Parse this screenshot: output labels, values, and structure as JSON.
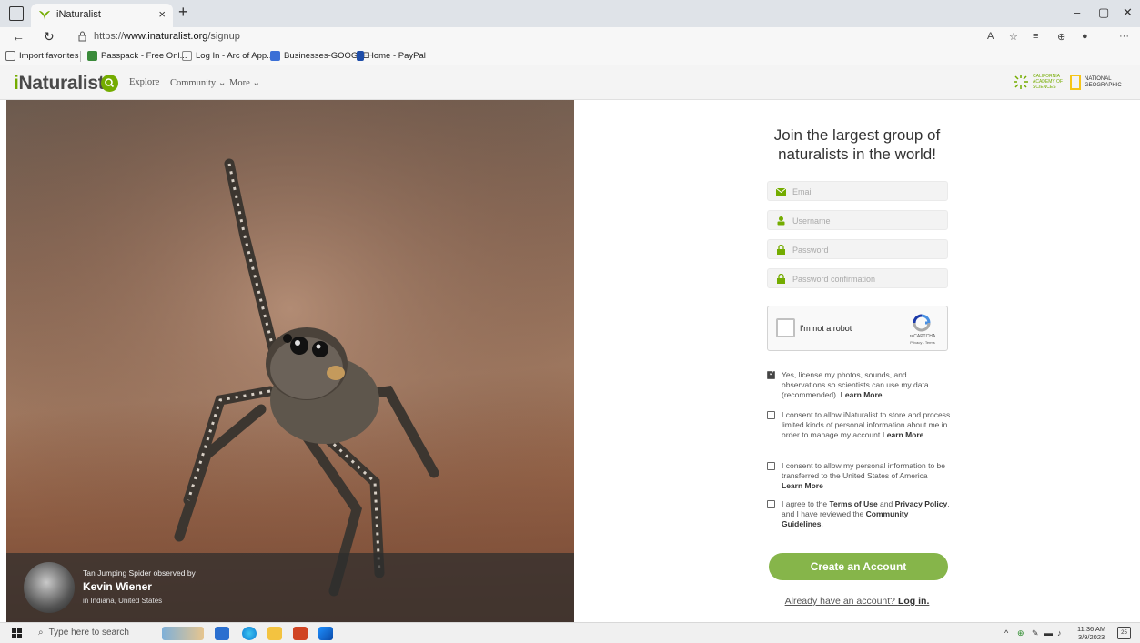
{
  "browser": {
    "tab_title": "iNaturalist",
    "tab_close": "×",
    "new_tab": "+",
    "url_prefix": "https://",
    "url_host": "www.inaturalist.org",
    "url_path": "/signup",
    "window_controls": [
      "–",
      "▢",
      "✕"
    ],
    "favorites": [
      {
        "label": "Import favorites",
        "color": "#666666"
      },
      {
        "label": "Passpack - Free Onl...",
        "color": "#3a8a3a"
      },
      {
        "label": "Log In - Arc of App...",
        "color": "#888888"
      },
      {
        "label": "Businesses-GOOGLE",
        "color": "#3b6fd6"
      },
      {
        "label": "Home - PayPal",
        "color": "#1e4da8"
      }
    ]
  },
  "site": {
    "logo_i": "i",
    "logo_rest": "Naturalist",
    "nav": [
      "Explore",
      "Community ⌄",
      "More ⌄"
    ],
    "sponsor1": "CALIFORNIA ACADEMY OF SCIENCES",
    "sponsor2": "NATIONAL GEOGRAPHIC",
    "accent": "#74ac00"
  },
  "hero": {
    "caption_line": "Tan Jumping Spider observed by",
    "observer": "Kevin Wiener",
    "location": "in Indiana, United States"
  },
  "form": {
    "title": "Join the largest group of naturalists in the world!",
    "email_placeholder": "Email",
    "username_placeholder": "Username",
    "password_placeholder": "Password",
    "password_confirm_placeholder": "Password confirmation",
    "captcha_label": "I'm not a robot",
    "captcha_brand": "reCAPTCHA",
    "captcha_privacy": "Privacy - Terms",
    "checks": [
      {
        "checked": true,
        "text": "Yes, license my photos, sounds, and observations so scientists can use my data (recommended). ",
        "link": "Learn More"
      },
      {
        "checked": false,
        "text": "I consent to allow iNaturalist to store and process limited kinds of personal information about me in order to manage my account ",
        "link": "Learn More"
      },
      {
        "checked": false,
        "text": "I consent to allow my personal information to be transferred to the United States of America ",
        "link": "Learn More"
      }
    ],
    "terms": {
      "pre": "I agree to the ",
      "terms_link": "Terms of Use",
      "and": " and ",
      "privacy_link": "Privacy Policy",
      "mid": ", and I have reviewed the ",
      "guidelines_link": "Community Guidelines",
      "end": "."
    },
    "submit": "Create an Account",
    "login_prompt": "Already have an account? ",
    "login_link": "Log in."
  },
  "taskbar": {
    "search_placeholder": "Type here to search",
    "time": "11:36 AM",
    "date": "3/9/2023",
    "notif_count": "25"
  }
}
